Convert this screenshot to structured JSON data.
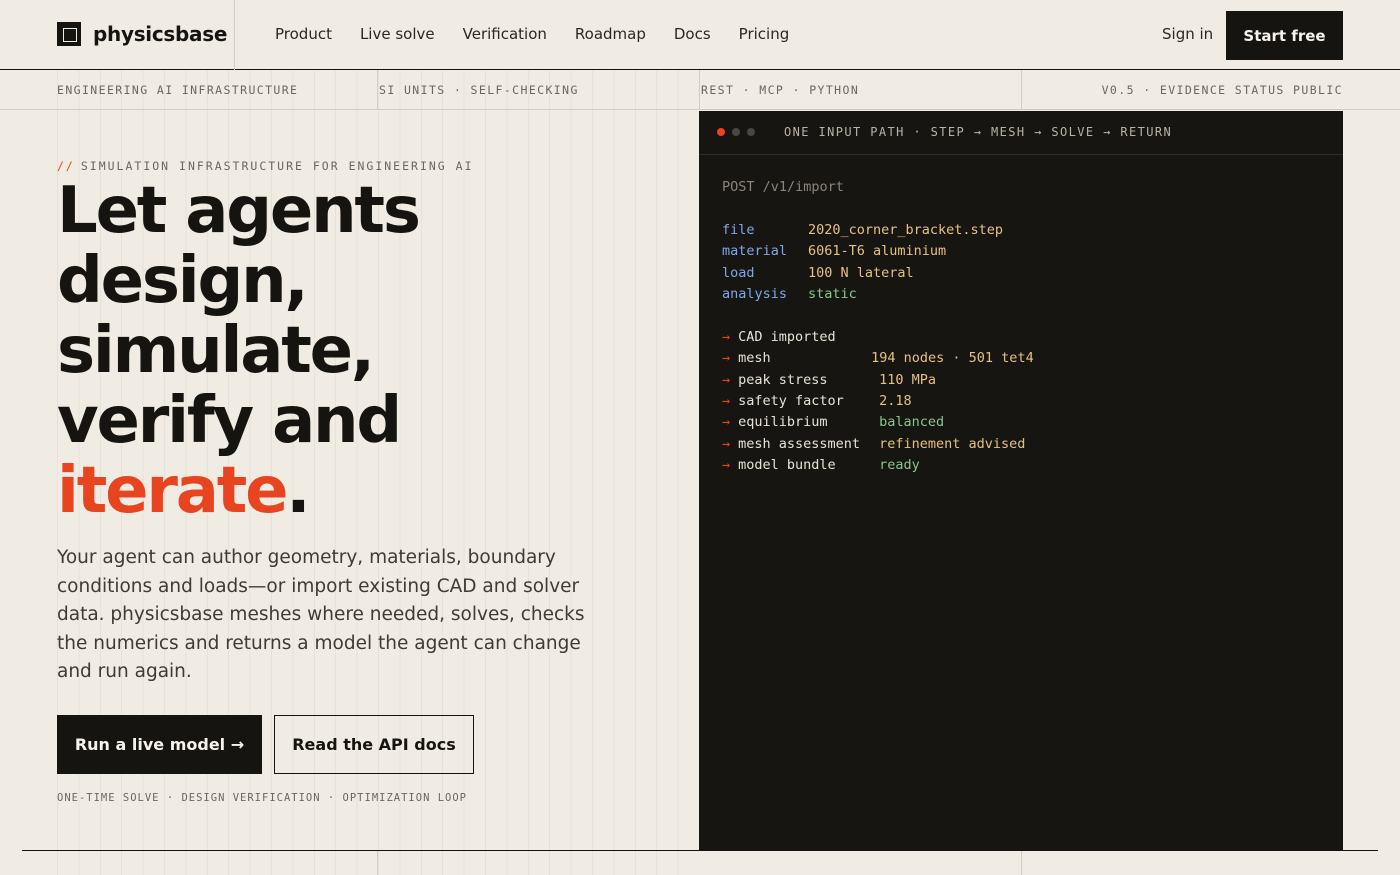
{
  "brand": {
    "name": "physicsbase"
  },
  "nav": {
    "items": [
      "Product",
      "Live solve",
      "Verification",
      "Roadmap",
      "Docs",
      "Pricing"
    ],
    "sign_in": "Sign in",
    "start_free": "Start free"
  },
  "ticker": {
    "items": [
      "ENGINEERING AI INFRASTRUCTURE",
      "SI UNITS · SELF-CHECKING",
      "REST · MCP · PYTHON",
      "V0.5 · EVIDENCE STATUS PUBLIC"
    ]
  },
  "hero": {
    "eyebrow_marker": "//",
    "eyebrow": "SIMULATION INFRASTRUCTURE FOR ENGINEERING AI",
    "headline_lines": [
      "Let agents",
      "design,",
      "simulate,",
      "verify and"
    ],
    "headline_accent": "iterate",
    "headline_end": ".",
    "lede": "Your agent can author geometry, materials, boundary conditions and loads—or import existing CAD and solver data. physicsbase meshes where needed, solves, checks the numerics and returns a model the agent can change and run again.",
    "primary_cta": "Run a live model →",
    "secondary_cta": "Read the API docs",
    "footnote": "ONE-TIME SOLVE · DESIGN VERIFICATION · OPTIMIZATION LOOP"
  },
  "terminal": {
    "title": "ONE INPUT PATH · STEP → MESH → SOLVE → RETURN",
    "request": "POST /v1/import",
    "inputs": [
      {
        "key": "file",
        "value": "2020_corner_bracket.step"
      },
      {
        "key": "material",
        "value": "6061-T6 aluminium"
      },
      {
        "key": "load",
        "value": "100 N lateral"
      },
      {
        "key": "analysis",
        "value": "static"
      }
    ],
    "arrow": "→",
    "results": [
      {
        "label": "CAD imported",
        "value": ""
      },
      {
        "label": "mesh",
        "value": "194 nodes · 501 tet4"
      },
      {
        "label": "peak stress",
        "value": "110 MPa"
      },
      {
        "label": "safety factor",
        "value": "2.18"
      },
      {
        "label": "equilibrium",
        "value": "balanced"
      },
      {
        "label": "mesh assessment",
        "value": "refinement advised"
      },
      {
        "label": "model bundle",
        "value": "ready"
      }
    ]
  },
  "colors": {
    "background": "#f0ece4",
    "ink": "#161410",
    "accent": "#e8441f",
    "terminal_bg": "#171512",
    "terminal_key": "#7fa7e8",
    "terminal_value": "#e6c184",
    "terminal_ok": "#88c68a"
  }
}
